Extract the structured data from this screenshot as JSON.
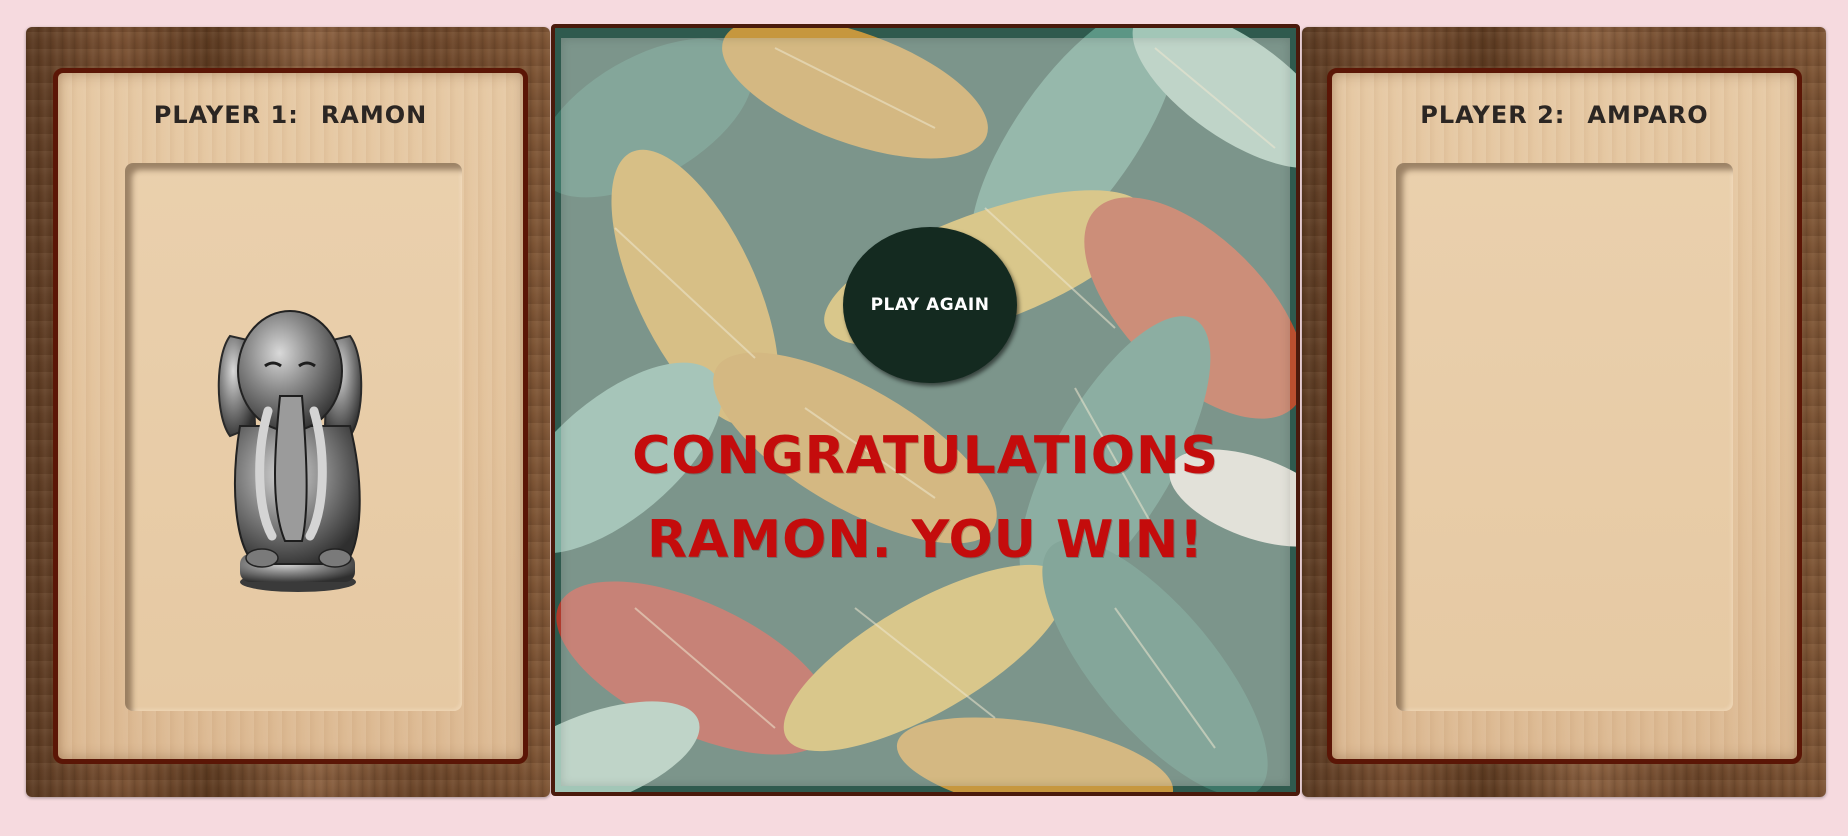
{
  "player1": {
    "label": "PLAYER 1:",
    "name": "RAMON",
    "token_icon": "elephant-figurine"
  },
  "player2": {
    "label": "PLAYER 2:",
    "name": "AMPARO"
  },
  "center": {
    "play_again_label": "PLAY AGAIN",
    "win_line1": "CONGRATULATIONS",
    "win_line2": "RAMON. YOU WIN!"
  },
  "colors": {
    "page_background": "#f6dadf",
    "card_border": "#5b1606",
    "button_fill": "#142a20",
    "win_text": "#c40c0c"
  }
}
